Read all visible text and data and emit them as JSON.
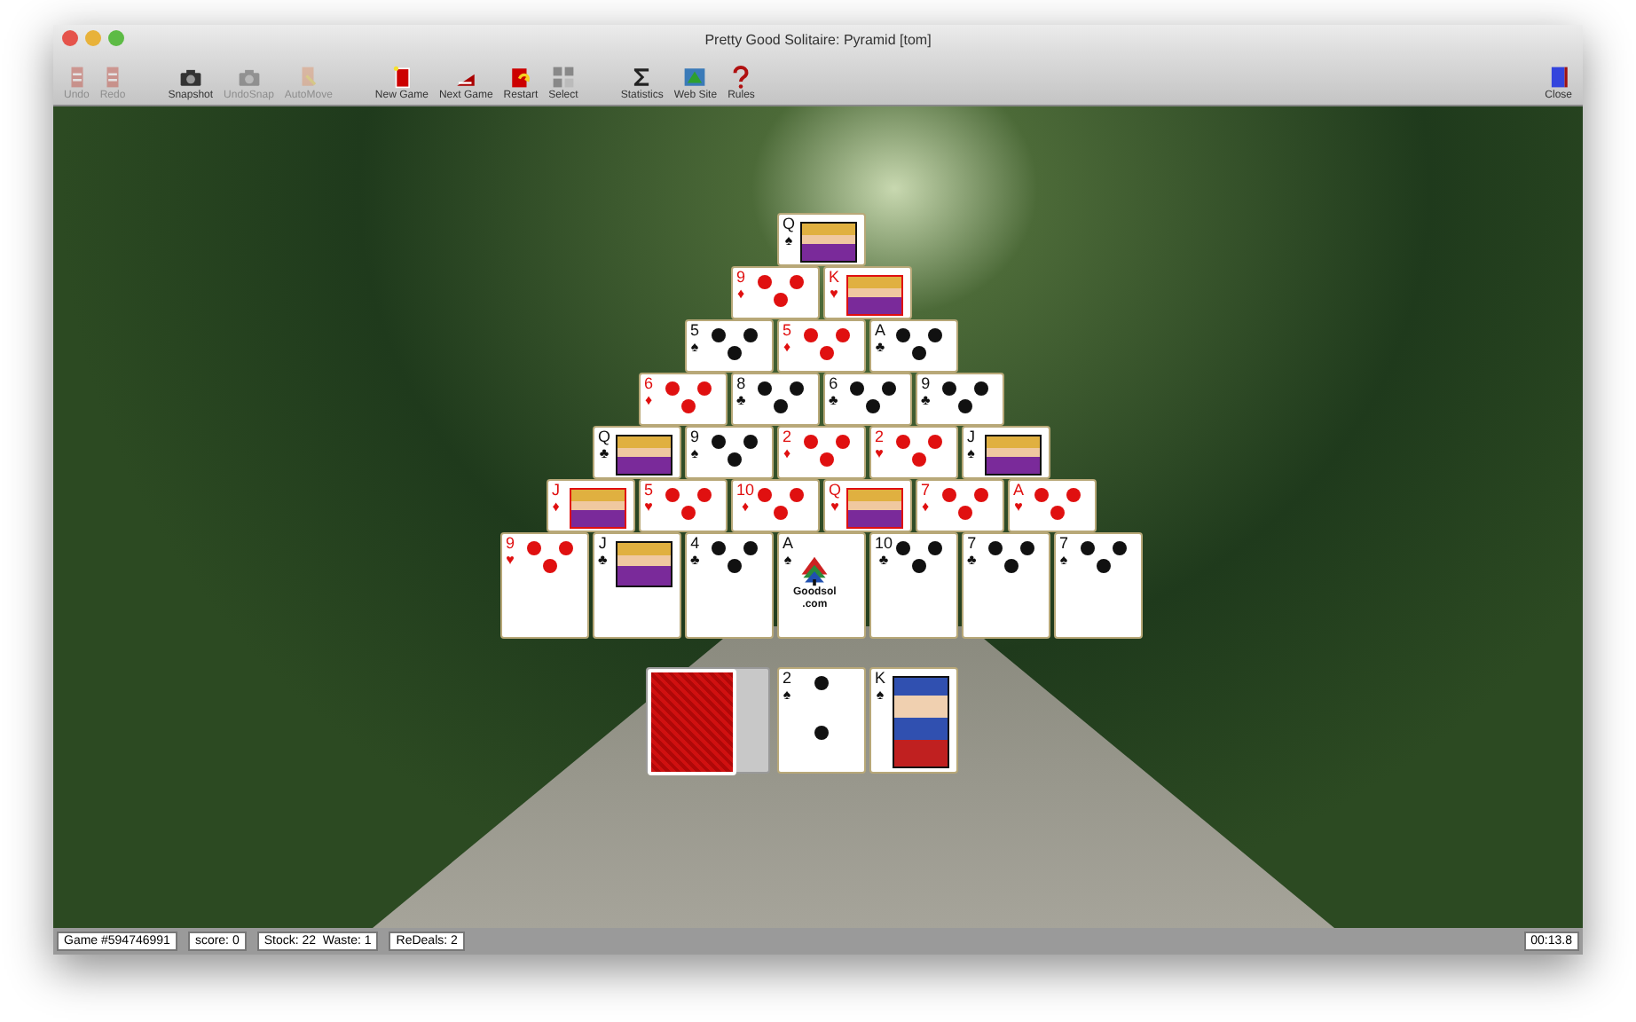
{
  "window": {
    "title": "Pretty Good Solitaire: Pyramid [tom]"
  },
  "toolbar": [
    {
      "label": "Undo",
      "kind": "undo",
      "disabled": true
    },
    {
      "label": "Redo",
      "kind": "redo",
      "disabled": true
    },
    {
      "label": "Snapshot",
      "kind": "camera",
      "disabled": false
    },
    {
      "label": "UndoSnap",
      "kind": "camera",
      "disabled": true
    },
    {
      "label": "AutoMove",
      "kind": "automove",
      "disabled": true
    },
    {
      "label": "New Game",
      "kind": "newgame",
      "disabled": false
    },
    {
      "label": "Next Game",
      "kind": "nextgame",
      "disabled": false
    },
    {
      "label": "Restart",
      "kind": "restart",
      "disabled": false
    },
    {
      "label": "Select",
      "kind": "select",
      "disabled": false
    },
    {
      "label": "Statistics",
      "kind": "sigma",
      "disabled": false
    },
    {
      "label": "Web Site",
      "kind": "website",
      "disabled": false
    },
    {
      "label": "Rules",
      "kind": "rules",
      "disabled": false
    }
  ],
  "close_button": {
    "label": "Close"
  },
  "pyramid": [
    [
      {
        "rank": "Q",
        "suit": "♠",
        "color": "#111111",
        "kind": "face"
      }
    ],
    [
      {
        "rank": "9",
        "suit": "♦",
        "color": "#e01010",
        "kind": "pips"
      },
      {
        "rank": "K",
        "suit": "♥",
        "color": "#e01010",
        "kind": "face"
      }
    ],
    [
      {
        "rank": "5",
        "suit": "♠",
        "color": "#111111",
        "kind": "pips"
      },
      {
        "rank": "5",
        "suit": "♦",
        "color": "#e01010",
        "kind": "pips"
      },
      {
        "rank": "A",
        "suit": "♣",
        "color": "#111111",
        "kind": "pips"
      }
    ],
    [
      {
        "rank": "6",
        "suit": "♦",
        "color": "#e01010",
        "kind": "pips"
      },
      {
        "rank": "8",
        "suit": "♣",
        "color": "#111111",
        "kind": "pips"
      },
      {
        "rank": "6",
        "suit": "♣",
        "color": "#111111",
        "kind": "pips"
      },
      {
        "rank": "9",
        "suit": "♣",
        "color": "#111111",
        "kind": "pips"
      }
    ],
    [
      {
        "rank": "Q",
        "suit": "♣",
        "color": "#111111",
        "kind": "face"
      },
      {
        "rank": "9",
        "suit": "♠",
        "color": "#111111",
        "kind": "pips"
      },
      {
        "rank": "2",
        "suit": "♦",
        "color": "#e01010",
        "kind": "pips"
      },
      {
        "rank": "2",
        "suit": "♥",
        "color": "#e01010",
        "kind": "pips"
      },
      {
        "rank": "J",
        "suit": "♠",
        "color": "#111111",
        "kind": "face"
      }
    ],
    [
      {
        "rank": "J",
        "suit": "♦",
        "color": "#e01010",
        "kind": "face"
      },
      {
        "rank": "5",
        "suit": "♥",
        "color": "#e01010",
        "kind": "pips"
      },
      {
        "rank": "10",
        "suit": "♦",
        "color": "#e01010",
        "kind": "pips"
      },
      {
        "rank": "Q",
        "suit": "♥",
        "color": "#e01010",
        "kind": "face"
      },
      {
        "rank": "7",
        "suit": "♦",
        "color": "#e01010",
        "kind": "pips"
      },
      {
        "rank": "A",
        "suit": "♥",
        "color": "#e01010",
        "kind": "pips"
      }
    ],
    [
      {
        "rank": "9",
        "suit": "♥",
        "color": "#e01010",
        "kind": "pips"
      },
      {
        "rank": "J",
        "suit": "♣",
        "color": "#111111",
        "kind": "face"
      },
      {
        "rank": "4",
        "suit": "♣",
        "color": "#111111",
        "kind": "pips"
      },
      {
        "rank": "A",
        "suit": "♠",
        "color": "#111111",
        "kind": "logo",
        "logo_text": "Goodsol",
        "logo_subtext": ".com"
      },
      {
        "rank": "10",
        "suit": "♣",
        "color": "#111111",
        "kind": "pips"
      },
      {
        "rank": "7",
        "suit": "♣",
        "color": "#111111",
        "kind": "pips"
      },
      {
        "rank": "7",
        "suit": "♠",
        "color": "#111111",
        "kind": "pips"
      }
    ]
  ],
  "waste": [
    {
      "rank": "2",
      "suit": "♠",
      "color": "#111111",
      "kind": "pips"
    },
    {
      "rank": "K",
      "suit": "♠",
      "color": "#111111",
      "kind": "face"
    }
  ],
  "status_bar": {
    "game": "Game #594746991",
    "score": "score: 0",
    "stock_waste": "Stock: 22  Waste: 1",
    "redeals": "ReDeals: 2",
    "timer": "00:13.8"
  }
}
